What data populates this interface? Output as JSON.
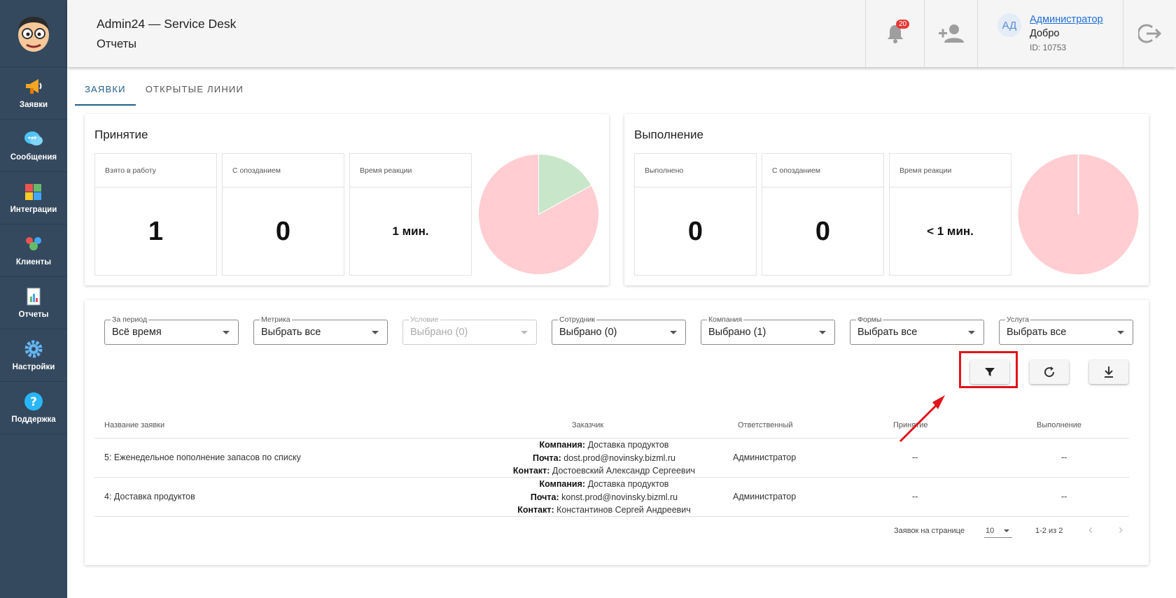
{
  "app": {
    "title": "Admin24 — Service Desk",
    "page": "Отчеты"
  },
  "sidebar": {
    "items": [
      {
        "label": "Заявки",
        "icon": "megaphone-icon"
      },
      {
        "label": "Сообщения",
        "icon": "chat-icon"
      },
      {
        "label": "Интеграции",
        "icon": "puzzle-icon"
      },
      {
        "label": "Клиенты",
        "icon": "users-icon"
      },
      {
        "label": "Отчеты",
        "icon": "report-icon"
      },
      {
        "label": "Настройки",
        "icon": "gear-icon"
      },
      {
        "label": "Поддержка",
        "icon": "help-icon"
      }
    ]
  },
  "header": {
    "notifications_count": "20",
    "user": {
      "initials": "АД",
      "name": "Администратор",
      "greeting": "Добро",
      "id": "ID: 10753"
    }
  },
  "tabs": [
    {
      "label": "ЗАЯВКИ",
      "active": true
    },
    {
      "label": "ОТКРЫТЫЕ ЛИНИИ",
      "active": false
    }
  ],
  "acceptance": {
    "title": "Принятие",
    "stats": [
      {
        "label": "Взято в работу",
        "value": "1"
      },
      {
        "label": "С опозданием",
        "value": "0"
      },
      {
        "label": "Время реакции",
        "value": "1 мин."
      }
    ],
    "pie": {
      "green_fraction": 0.17,
      "green_color": "#c8e6c9",
      "red_color": "#ffcdd2"
    }
  },
  "completion": {
    "title": "Выполнение",
    "stats": [
      {
        "label": "Выполнено",
        "value": "0"
      },
      {
        "label": "С опозданием",
        "value": "0"
      },
      {
        "label": "Время реакции",
        "value": "< 1 мин."
      }
    ],
    "pie": {
      "red_color": "#ffcdd2"
    }
  },
  "filters": [
    {
      "label": "За период",
      "value": "Всё время",
      "disabled": false
    },
    {
      "label": "Метрика",
      "value": "Выбрать все",
      "disabled": false
    },
    {
      "label": "Условие",
      "value": "Выбрано (0)",
      "disabled": true
    },
    {
      "label": "Сотрудник",
      "value": "Выбрано (0)",
      "disabled": false
    },
    {
      "label": "Компания",
      "value": "Выбрано (1)",
      "disabled": false
    },
    {
      "label": "Формы",
      "value": "Выбрать все",
      "disabled": false
    },
    {
      "label": "Услуга",
      "value": "Выбрать все",
      "disabled": false
    }
  ],
  "table": {
    "headers": [
      "Название заявки",
      "Заказчик",
      "Ответственный",
      "Принятие",
      "Выполнение"
    ],
    "customer_labels": {
      "company": "Компания:",
      "email": "Почта:",
      "contact": "Контакт:"
    },
    "rows": [
      {
        "name": "5: Еженедельное пополнение запасов по списку",
        "company": "Доставка продуктов",
        "email": "dost.prod@novinsky.bizml.ru",
        "contact": "Достоевский Александр Сергеевич",
        "responsible": "Администратор",
        "accept": "--",
        "done": "--"
      },
      {
        "name": "4: Доставка продуктов",
        "company": "Доставка продуктов",
        "email": "konst.prod@novinsky.bizml.ru",
        "contact": "Константинов Сергей Андреевич",
        "responsible": "Администратор",
        "accept": "--",
        "done": "--"
      }
    ]
  },
  "pagination": {
    "per_page_label": "Заявок на странице",
    "per_page": "10",
    "range": "1-2 из 2"
  },
  "colors": {
    "sidebar": "#34495e",
    "accent": "#1f5f8b",
    "highlight": "#e0141b"
  }
}
